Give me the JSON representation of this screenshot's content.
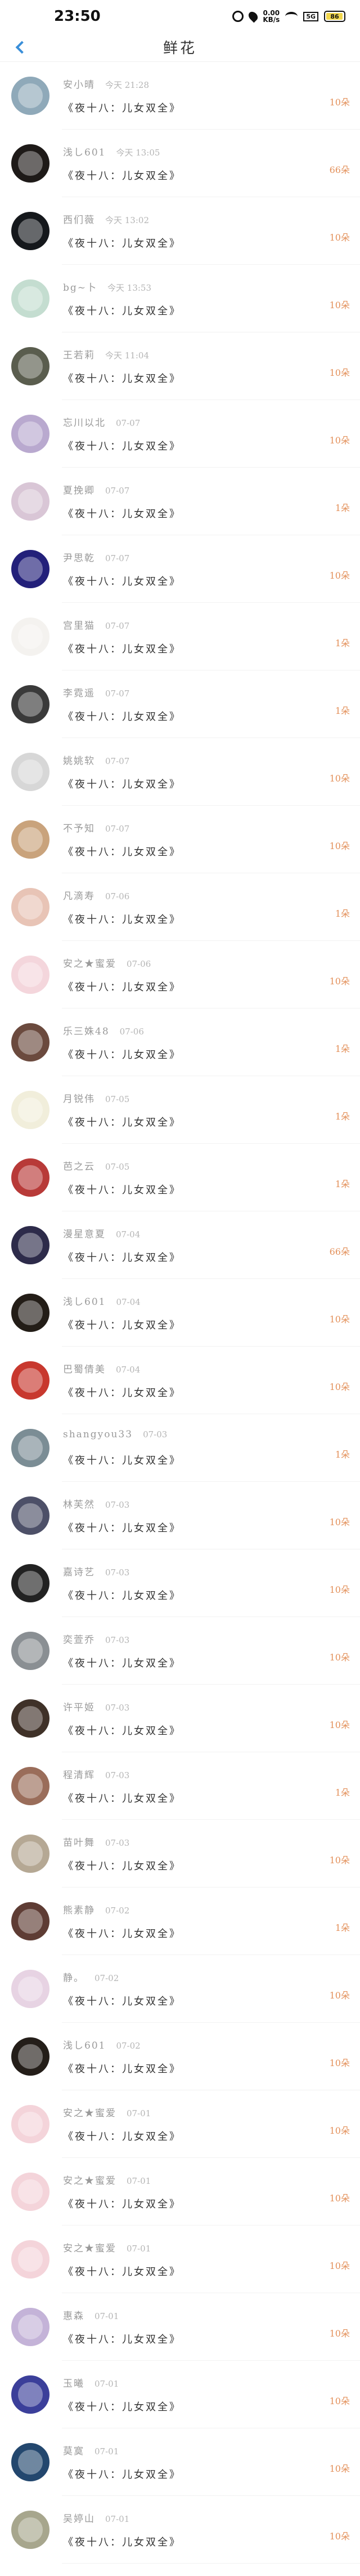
{
  "status_bar": {
    "time": "23:50",
    "net_speed_value": "0.00",
    "net_speed_unit": "KB/s",
    "signal_badge": "5G",
    "battery_level": "86",
    "battery_fraction": 0.86
  },
  "header": {
    "title": "鲜花"
  },
  "colors": {
    "amount": "#e3905a",
    "back_arrow": "#3a8fd9",
    "name": "#9a9a9a"
  },
  "records": [
    {
      "name": "安小晴",
      "time": "今天 21:28",
      "work": "《夜十八：儿女双全》",
      "amount": "10朵",
      "avatar_color": "#8fa9b9"
    },
    {
      "name": "浅し601",
      "time": "今天 13:05",
      "work": "《夜十八：儿女双全》",
      "amount": "66朵",
      "avatar_color": "#1e1a18"
    },
    {
      "name": "西们薇",
      "time": "今天 13:02",
      "work": "《夜十八：儿女双全》",
      "amount": "10朵",
      "avatar_color": "#15181c"
    },
    {
      "name": "bg~卜",
      "time": "今天 13:53",
      "work": "《夜十八：儿女双全》",
      "amount": "10朵",
      "avatar_color": "#c4ddd0"
    },
    {
      "name": "王若莉",
      "time": "今天 11:04",
      "work": "《夜十八：儿女双全》",
      "amount": "10朵",
      "avatar_color": "#5a5d4e"
    },
    {
      "name": "忘川以北",
      "time": "07-07",
      "work": "《夜十八：儿女双全》",
      "amount": "10朵",
      "avatar_color": "#b9a9cf"
    },
    {
      "name": "夏挽卿",
      "time": "07-07",
      "work": "《夜十八：儿女双全》",
      "amount": "1朵",
      "avatar_color": "#d9c6d6"
    },
    {
      "name": "尹思乾",
      "time": "07-07",
      "work": "《夜十八：儿女双全》",
      "amount": "10朵",
      "avatar_color": "#23207a"
    },
    {
      "name": "宫里猫",
      "time": "07-07",
      "work": "《夜十八：儿女双全》",
      "amount": "1朵",
      "avatar_color": "#f4f2ef"
    },
    {
      "name": "李霓遥",
      "time": "07-07",
      "work": "《夜十八：儿女双全》",
      "amount": "1朵",
      "avatar_color": "#3a3a3a"
    },
    {
      "name": "姚姚软",
      "time": "07-07",
      "work": "《夜十八：儿女双全》",
      "amount": "10朵",
      "avatar_color": "#d7d7d7"
    },
    {
      "name": "不予知",
      "time": "07-07",
      "work": "《夜十八：儿女双全》",
      "amount": "10朵",
      "avatar_color": "#c9a37c"
    },
    {
      "name": "凡滴寿",
      "time": "07-06",
      "work": "《夜十八：儿女双全》",
      "amount": "1朵",
      "avatar_color": "#e8c4b6"
    },
    {
      "name": "安之★蜜爱",
      "time": "07-06",
      "work": "《夜十八：儿女双全》",
      "amount": "10朵",
      "avatar_color": "#f4d6dc"
    },
    {
      "name": "乐三姝48",
      "time": "07-06",
      "work": "《夜十八：儿女双全》",
      "amount": "1朵",
      "avatar_color": "#6b4a3e"
    },
    {
      "name": "月锐伟",
      "time": "07-05",
      "work": "《夜十八：儿女双全》",
      "amount": "1朵",
      "avatar_color": "#f1eedb"
    },
    {
      "name": "芭之云",
      "time": "07-05",
      "work": "《夜十八：儿女双全》",
      "amount": "1朵",
      "avatar_color": "#b83a38"
    },
    {
      "name": "漫星意夏",
      "time": "07-04",
      "work": "《夜十八：儿女双全》",
      "amount": "66朵",
      "avatar_color": "#2d2b4a"
    },
    {
      "name": "浅し601",
      "time": "07-04",
      "work": "《夜十八：儿女双全》",
      "amount": "10朵",
      "avatar_color": "#231d17"
    },
    {
      "name": "巴蜀倩美",
      "time": "07-04",
      "work": "《夜十八：儿女双全》",
      "amount": "10朵",
      "avatar_color": "#c8382e"
    },
    {
      "name": "shangyou33",
      "time": "07-03",
      "work": "《夜十八：儿女双全》",
      "amount": "1朵",
      "avatar_color": "#7b8d95"
    },
    {
      "name": "林芙然",
      "time": "07-03",
      "work": "《夜十八：儿女双全》",
      "amount": "10朵",
      "avatar_color": "#4d5068"
    },
    {
      "name": "嘉诗艺",
      "time": "07-03",
      "work": "《夜十八：儿女双全》",
      "amount": "10朵",
      "avatar_color": "#222222"
    },
    {
      "name": "奕萱乔",
      "time": "07-03",
      "work": "《夜十八：儿女双全》",
      "amount": "10朵",
      "avatar_color": "#8a8f93"
    },
    {
      "name": "许平姬",
      "time": "07-03",
      "work": "《夜十八：儿女双全》",
      "amount": "10朵",
      "avatar_color": "#3f3128"
    },
    {
      "name": "程清辉",
      "time": "07-03",
      "work": "《夜十八：儿女双全》",
      "amount": "1朵",
      "avatar_color": "#9a6d5a"
    },
    {
      "name": "苗叶舞",
      "time": "07-03",
      "work": "《夜十八：儿女双全》",
      "amount": "10朵",
      "avatar_color": "#b5a894"
    },
    {
      "name": "熊素静",
      "time": "07-02",
      "work": "《夜十八：儿女双全》",
      "amount": "1朵",
      "avatar_color": "#5e3c34"
    },
    {
      "name": "静。",
      "time": "07-02",
      "work": "《夜十八：儿女双全》",
      "amount": "10朵",
      "avatar_color": "#e7d3e3"
    },
    {
      "name": "浅し601",
      "time": "07-02",
      "work": "《夜十八：儿女双全》",
      "amount": "10朵",
      "avatar_color": "#241e19"
    },
    {
      "name": "安之★蜜爱",
      "time": "07-01",
      "work": "《夜十八：儿女双全》",
      "amount": "10朵",
      "avatar_color": "#f4d4da"
    },
    {
      "name": "安之★蜜爱",
      "time": "07-01",
      "work": "《夜十八：儿女双全》",
      "amount": "10朵",
      "avatar_color": "#f4d4da"
    },
    {
      "name": "安之★蜜爱",
      "time": "07-01",
      "work": "《夜十八：儿女双全》",
      "amount": "10朵",
      "avatar_color": "#f4d4da"
    },
    {
      "name": "惠森",
      "time": "07-01",
      "work": "《夜十八：儿女双全》",
      "amount": "10朵",
      "avatar_color": "#c4b3d8"
    },
    {
      "name": "玉曦",
      "time": "07-01",
      "work": "《夜十八：儿女双全》",
      "amount": "10朵",
      "avatar_color": "#3b3f9a"
    },
    {
      "name": "莫寞",
      "time": "07-01",
      "work": "《夜十八：儿女双全》",
      "amount": "10朵",
      "avatar_color": "#23476e"
    },
    {
      "name": "吴婷山",
      "time": "07-01",
      "work": "《夜十八：儿女双全》",
      "amount": "10朵",
      "avatar_color": "#a7a68d"
    }
  ]
}
